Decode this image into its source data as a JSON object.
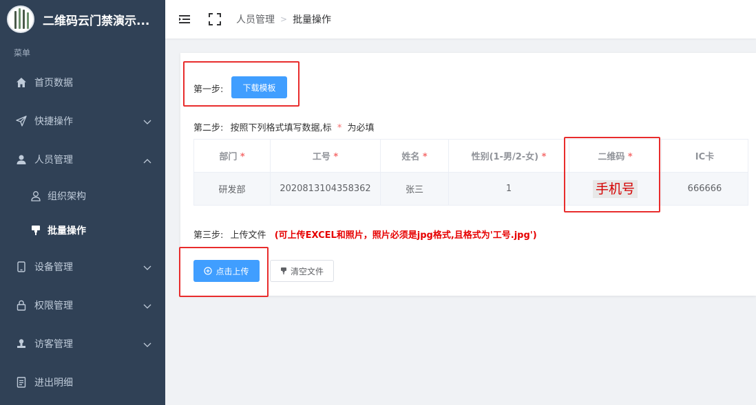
{
  "app": {
    "title": "二维码云门禁演示..."
  },
  "sidebar": {
    "caption": "菜单",
    "items": [
      {
        "label": "首页数据",
        "icon": "home-icon"
      },
      {
        "label": "快捷操作",
        "icon": "send-icon",
        "expandable": true
      },
      {
        "label": "人员管理",
        "icon": "user-icon",
        "expandable": true,
        "expanded": true
      },
      {
        "label": "设备管理",
        "icon": "tablet-icon",
        "expandable": true
      },
      {
        "label": "权限管理",
        "icon": "lock-icon",
        "expandable": true
      },
      {
        "label": "访客管理",
        "icon": "stamp-icon",
        "expandable": true
      },
      {
        "label": "进出明细",
        "icon": "document-icon"
      }
    ],
    "subitems": [
      {
        "label": "组织架构",
        "icon": "person-outline-icon",
        "active": false
      },
      {
        "label": "批量操作",
        "icon": "upload-pin-icon",
        "active": true
      }
    ]
  },
  "header": {
    "breadcrumb": [
      "人员管理",
      "批量操作"
    ]
  },
  "step1": {
    "label": "第一步:",
    "button": "下载模板"
  },
  "step2": {
    "label": "第二步:",
    "text_before": "按照下列格式填写数据,标",
    "star": "*",
    "text_after": "为必填"
  },
  "table": {
    "columns": [
      {
        "label": "部门",
        "required": true
      },
      {
        "label": "工号",
        "required": true
      },
      {
        "label": "姓名",
        "required": true
      },
      {
        "label": "性别(1-男/2-女)",
        "required": true
      },
      {
        "label": "二维码",
        "required": true
      },
      {
        "label": "IC卡",
        "required": false
      }
    ],
    "rows": [
      [
        "研发部",
        "2020813104358362",
        "张三",
        "1",
        "手机号",
        "666666"
      ]
    ]
  },
  "step3": {
    "label": "第三步:",
    "text": "上传文件",
    "note": "(可上传EXCEL和照片，照片必须是jpg格式,且格式为'工号.jpg')",
    "upload_button": "点击上传",
    "clear_button": "清空文件"
  },
  "colors": {
    "sidebar_bg": "#304156",
    "primary": "#409eff",
    "annotation_red": "#e82b2b"
  }
}
